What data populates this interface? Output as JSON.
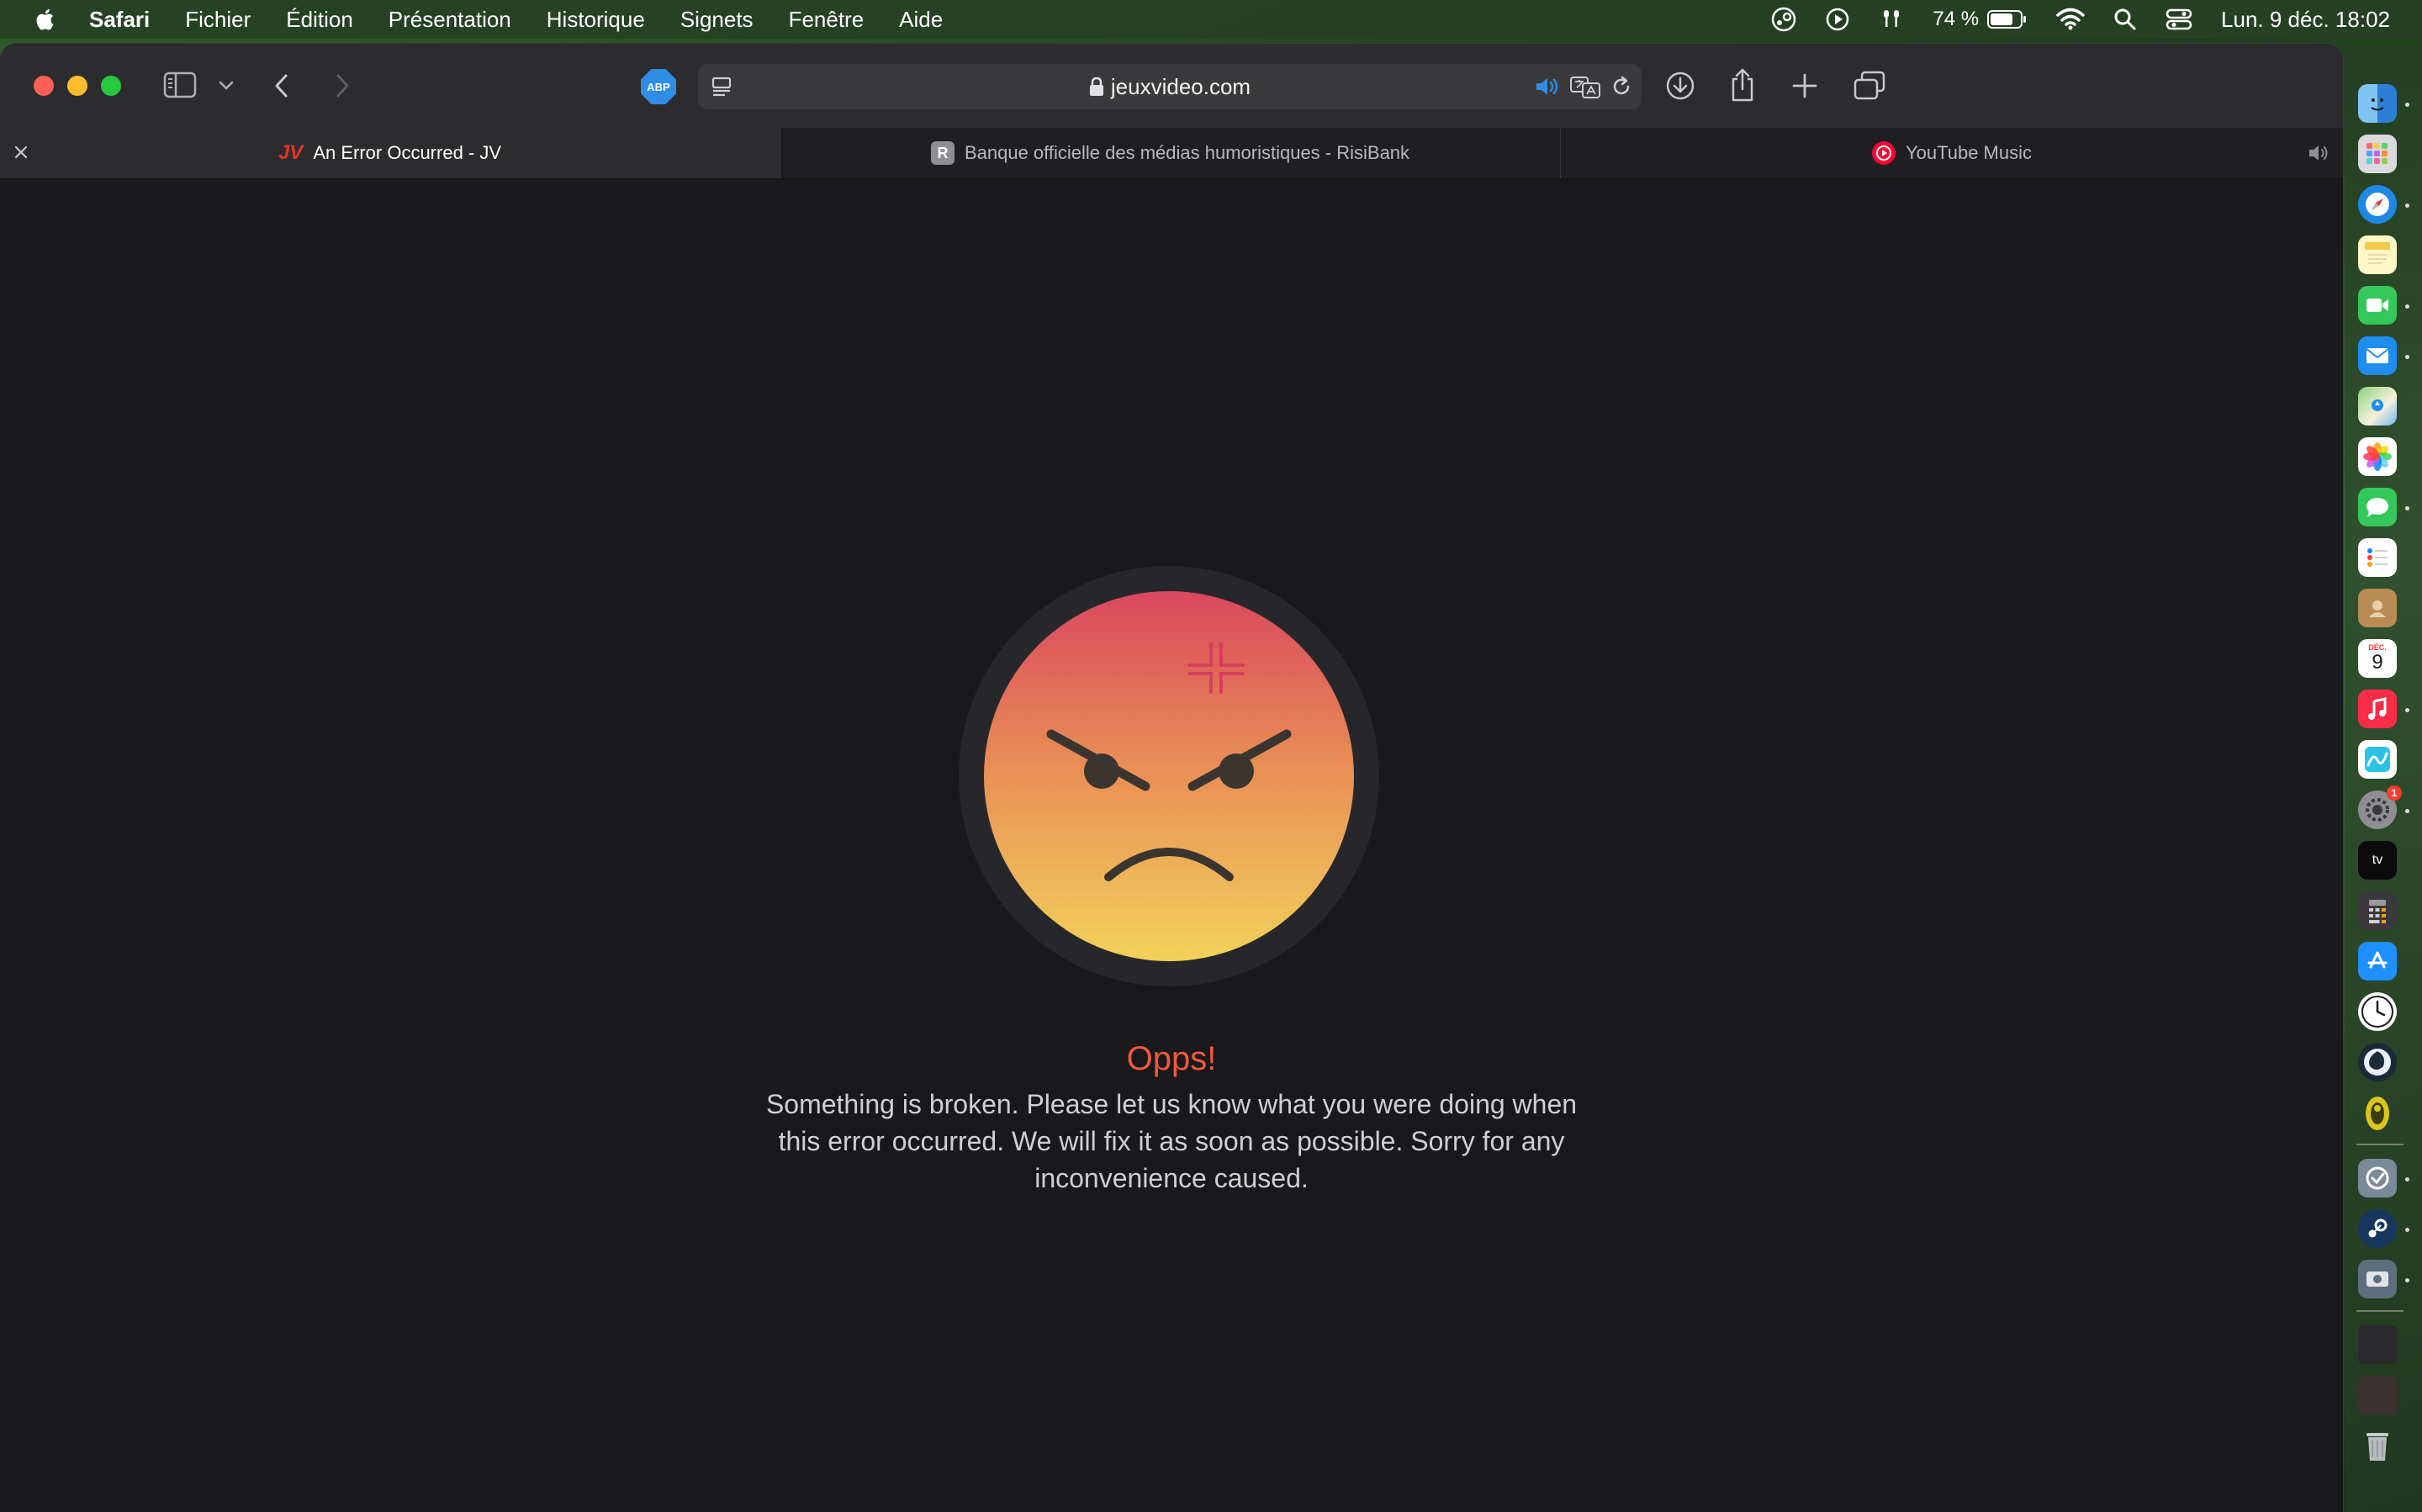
{
  "menubar": {
    "app_name": "Safari",
    "items": [
      "Fichier",
      "Édition",
      "Présentation",
      "Historique",
      "Signets",
      "Fenêtre",
      "Aide"
    ],
    "battery": "74 %",
    "datetime": "Lun. 9 déc.  18:02"
  },
  "toolbar": {
    "adblock_label": "ABP",
    "url": "jeuxvideo.com"
  },
  "tabs": [
    {
      "title": "An Error Occurred - JV",
      "favicon": "JV",
      "active": true
    },
    {
      "title": "Banque officielle des médias humoristiques - RisiBank",
      "favicon": "R",
      "active": false
    },
    {
      "title": "YouTube Music",
      "favicon": "youtube-music-icon",
      "active": false
    }
  ],
  "page": {
    "error_title": "Opps!",
    "error_message": "Something is broken. Please let us know what you were doing when this error occurred. We will fix it as soon as possible. Sorry for any inconvenience caused."
  },
  "dock": {
    "calendar_month": "DÉC.",
    "calendar_day": "9",
    "tv_label": "tv",
    "badge_count": "1"
  },
  "colors": {
    "error_title": "#ef5a3a",
    "face_top": "#d9475e",
    "face_bottom": "#f2d15a"
  }
}
